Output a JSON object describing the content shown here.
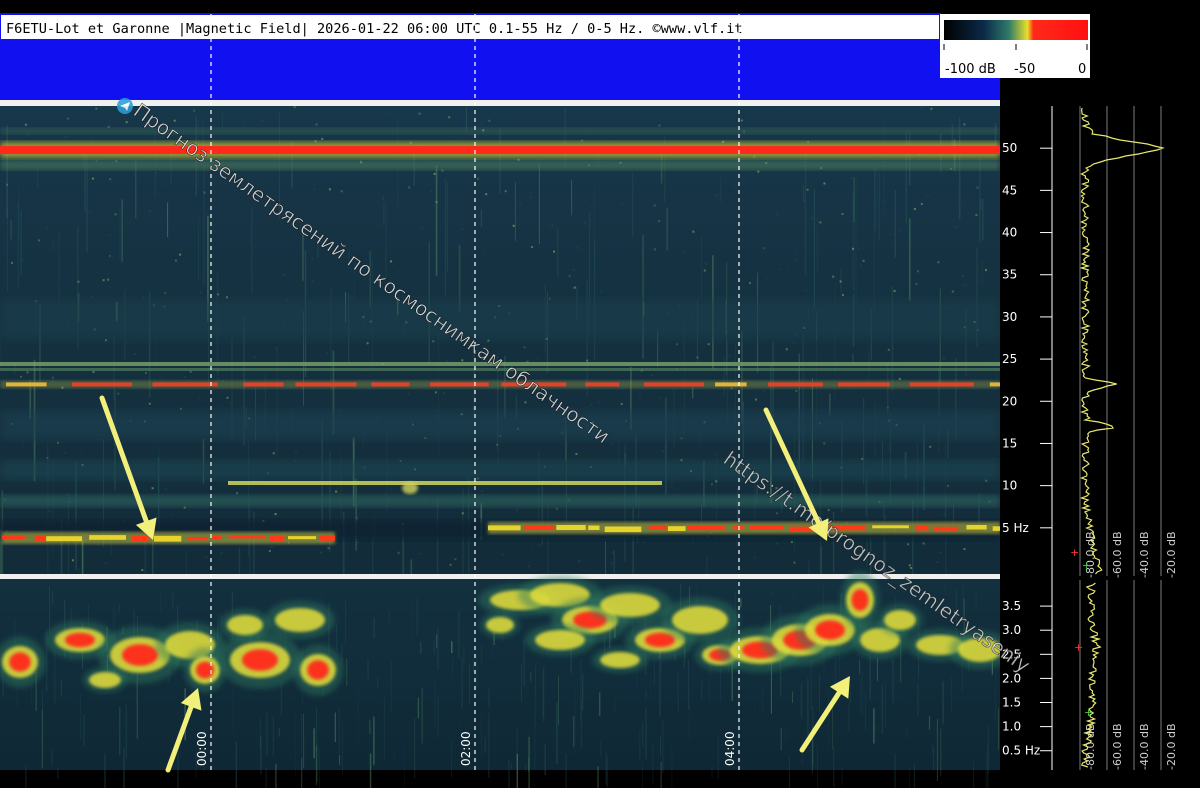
{
  "header": {
    "title": "F6ETU-Lot et Garonne |Magnetic Field| 2026-01-22 06:00 UTC 0.1-55 Hz / 0-5 Hz. ©www.vlf.it"
  },
  "colorbar": {
    "ticks": [
      "-100 dB",
      "-50",
      "0"
    ],
    "colors": [
      "#000000",
      "#0a2a4a",
      "#2f7a6a",
      "#e6e02a",
      "#ff2020"
    ]
  },
  "watermark": {
    "line1": "Прогноз землетрясений по космоснимкам облачности",
    "line2": "https://t.me/prognoz_zemletryaseniy"
  },
  "chart_data": [
    {
      "type": "heatmap",
      "title": "",
      "xlabel": "",
      "ylabel": "",
      "x_ticks": [
        "00:00",
        "02:00",
        "04:00"
      ],
      "y_unit": "Hz",
      "ylim": [
        0,
        55
      ],
      "y_ticks": [
        5,
        10,
        15,
        20,
        25,
        30,
        35,
        40,
        45,
        50
      ],
      "y_tick_labels": [
        "5 Hz",
        "10",
        "15",
        "20",
        "25",
        "30",
        "35",
        "40",
        "45",
        "50"
      ],
      "bands": [
        {
          "freq": 50,
          "level": "strong"
        },
        {
          "freq": 22,
          "level": "strong"
        },
        {
          "freq": 2.5,
          "level": "strong"
        },
        {
          "freq": 10,
          "level": "weak"
        }
      ]
    },
    {
      "type": "heatmap",
      "title": "",
      "xlabel": "",
      "ylabel": "",
      "x_ticks": [
        "00:00",
        "02:00",
        "04:00"
      ],
      "y_unit": "Hz",
      "ylim": [
        0.1,
        4
      ],
      "y_ticks": [
        0.5,
        1.0,
        1.5,
        2.0,
        2.5,
        3.0,
        3.5
      ],
      "y_tick_labels": [
        "0.5 Hz",
        "1.0",
        "1.5",
        "2.0",
        "2.5",
        "3.0",
        "3.5"
      ]
    },
    {
      "type": "line",
      "title": "",
      "x_unit": "dB",
      "x_ticks": [
        "-80.0 dB",
        "-60.0 dB",
        "-40.0 dB",
        "-20.0 dB"
      ],
      "peaks_hz": [
        50,
        22,
        17
      ]
    },
    {
      "type": "line",
      "title": "",
      "x_unit": "dB",
      "x_ticks": [
        "-80.0 dB",
        "-60.0 dB",
        "-40.0 dB",
        "-20.0 dB"
      ]
    }
  ],
  "annotations": {
    "arrow_color": "#f2ef7a",
    "arrows_count": 4
  }
}
